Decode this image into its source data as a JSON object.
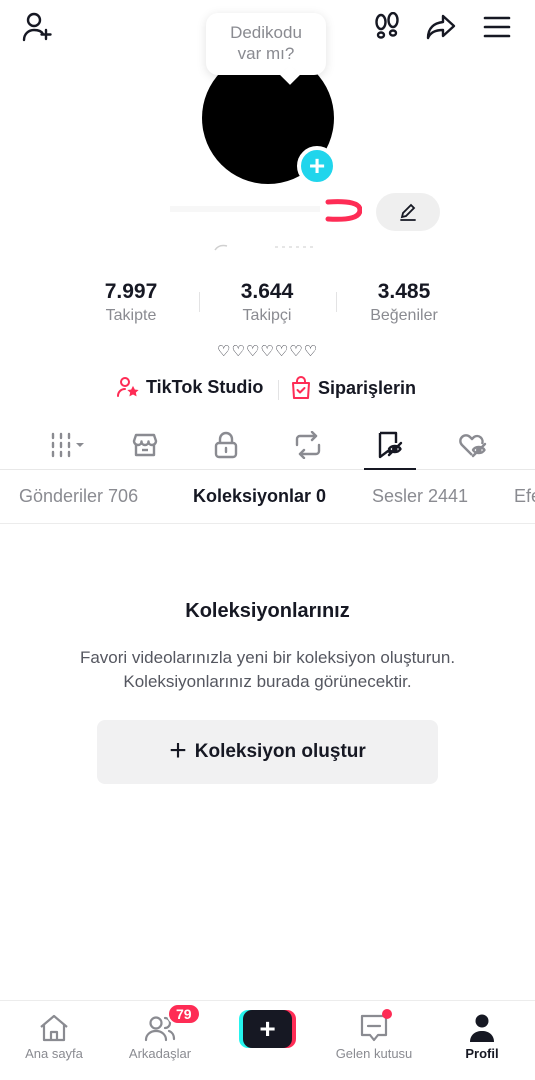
{
  "top": {
    "bubble_text": "Dedikodu var mı?"
  },
  "stats": [
    {
      "value": "7.997",
      "label": "Takipte"
    },
    {
      "value": "3.644",
      "label": "Takipçi"
    },
    {
      "value": "3.485",
      "label": "Beğeniler"
    }
  ],
  "bio": "♡♡♡♡♡♡♡",
  "links": {
    "studio": "TikTok Studio",
    "orders": "Siparişlerin"
  },
  "content_tabs": [
    {
      "label": "Gönderiler 706",
      "active": false
    },
    {
      "label": "Koleksiyonlar 0",
      "active": true
    },
    {
      "label": "Sesler 2441",
      "active": false
    },
    {
      "label": "Efe",
      "active": false
    }
  ],
  "empty_state": {
    "title": "Koleksiyonlarınız",
    "description": "Favori videolarınızla yeni bir koleksiyon oluşturun. Koleksiyonlarınız burada görünecektir.",
    "button_label": "Koleksiyon oluştur",
    "button_icon": "+"
  },
  "bottom_nav": {
    "home": "Ana sayfa",
    "friends": "Arkadaşlar",
    "friends_badge": "79",
    "create_icon": "+",
    "inbox": "Gelen kutusu",
    "profile": "Profil"
  },
  "colors": {
    "accent": "#fe2c55",
    "cyan": "#25f4ee",
    "avatar_plus": "#20d5ec",
    "text_primary": "#161823",
    "text_secondary": "#8a8b91"
  }
}
